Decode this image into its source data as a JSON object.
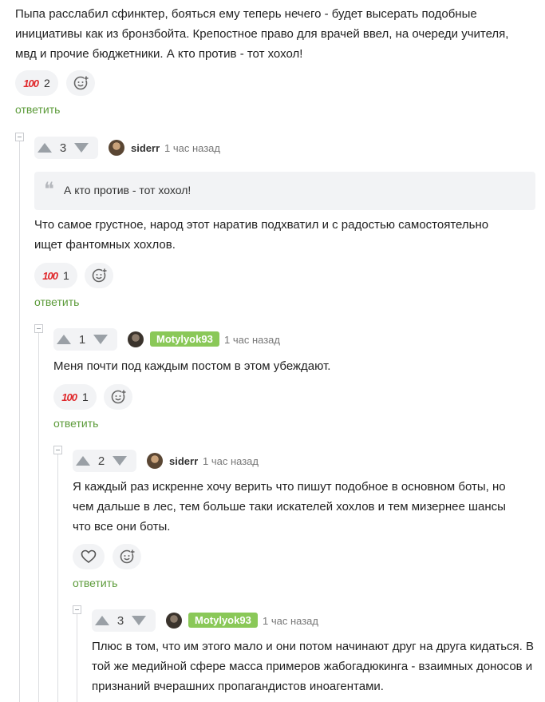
{
  "comment0": {
    "text": "Пыпа расслабил сфинктер, бояться ему теперь нечего - будет высерать подобные инициативы как из бронзбойта. Крепостное право для врачей ввел, на очереди учителя, мвд и прочие бюджетники. А кто против - тот хохол!",
    "reaction_emoji": "💯",
    "reaction_count": "2",
    "reply_label": "ответить"
  },
  "comment1": {
    "votes": "3",
    "username": "siderr",
    "time": "1 час назад",
    "quote": "А кто против - тот хохол!",
    "text": "Что самое грустное, народ этот наратив подхватил и с радостью самостоятельно ищет фантомных хохлов.",
    "reaction_emoji": "💯",
    "reaction_count": "1",
    "reply_label": "ответить"
  },
  "comment2": {
    "votes": "1",
    "username": "Motylyok93",
    "time": "1 час назад",
    "text": "Меня почти под каждым постом в этом убеждают.",
    "reaction_emoji": "💯",
    "reaction_count": "1",
    "reply_label": "ответить"
  },
  "comment3": {
    "votes": "2",
    "username": "siderr",
    "time": "1 час назад",
    "text": "Я каждый раз искренне хочу верить что пишут подобное в основном боты, но чем дальше в лес, тем больше таки искателей хохлов и тем мизернее шансы что все они боты.",
    "reply_label": "ответить"
  },
  "comment4": {
    "votes": "3",
    "username": "Motylyok93",
    "time": "1 час назад",
    "text": "Плюс в том, что им этого мало и они потом начинают друг на друга кидаться. В той же медийной сфере масса примеров жабогадюкинга - взаимных доносов и признаний вчерашних пропагандистов иноагентами."
  },
  "colors": {
    "accent": "#5c9b3a",
    "badge": "#8ac858",
    "pill": "#f2f3f5"
  }
}
